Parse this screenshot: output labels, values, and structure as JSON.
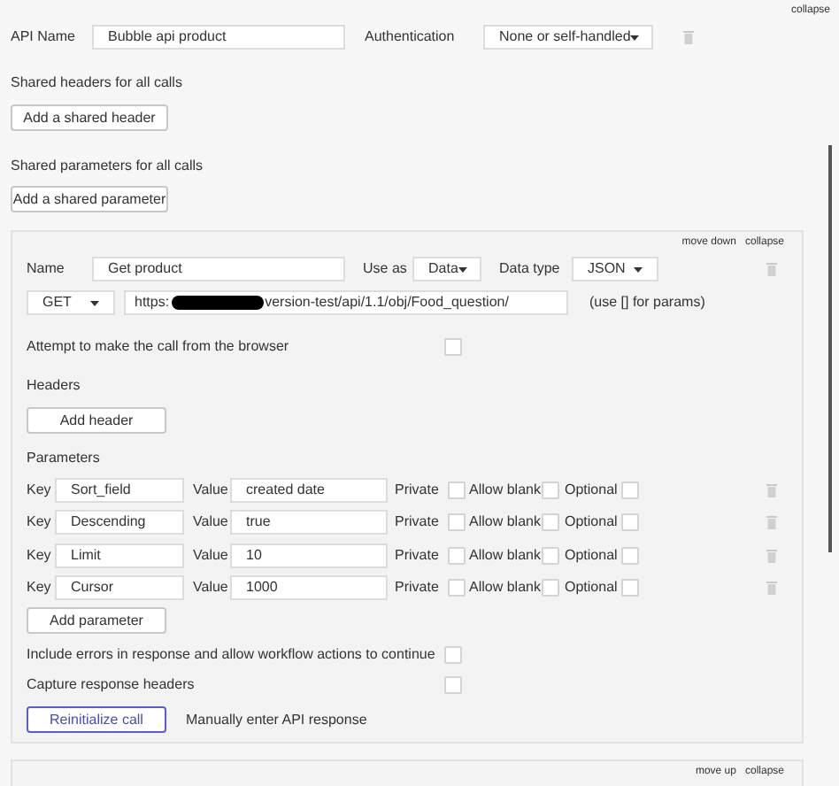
{
  "top_link": "collapse",
  "api": {
    "name_label": "API Name",
    "name_value": "Bubble api product",
    "auth_label": "Authentication",
    "auth_value": "None or self-handled"
  },
  "shared_headers": {
    "label": "Shared headers for all calls",
    "button": "Add a shared header"
  },
  "shared_params": {
    "label": "Shared parameters for all calls",
    "button": "Add a shared parameter"
  },
  "call": {
    "links": [
      "move down",
      "collapse"
    ],
    "name_label": "Name",
    "name_value": "Get product",
    "use_as_label": "Use as",
    "use_as_value": "Data",
    "data_type_label": "Data type",
    "data_type_value": "JSON",
    "method": "GET",
    "url_start": "https:",
    "url_end": "version-test/api/1.1/obj/Food_question/",
    "url_hint": "(use [] for params)",
    "browser_label": "Attempt to make the call from the browser",
    "browser_checked": false,
    "headers_label": "Headers",
    "add_header": "Add header",
    "parameters_label": "Parameters",
    "parameters": [
      {
        "key_label": "Key",
        "key": "Sort_field",
        "value_label": "Value",
        "value": "created date",
        "private_label": "Private",
        "private": false,
        "allow_blank_label": "Allow blank",
        "allow_blank": false,
        "optional_label": "Optional",
        "optional": false
      },
      {
        "key_label": "Key",
        "key": "Descending",
        "value_label": "Value",
        "value": "true",
        "private_label": "Private",
        "private": false,
        "allow_blank_label": "Allow blank",
        "allow_blank": false,
        "optional_label": "Optional",
        "optional": false
      },
      {
        "key_label": "Key",
        "key": "Limit",
        "value_label": "Value",
        "value": "10",
        "private_label": "Private",
        "private": false,
        "allow_blank_label": "Allow blank",
        "allow_blank": false,
        "optional_label": "Optional",
        "optional": false
      },
      {
        "key_label": "Key",
        "key": "Cursor",
        "value_label": "Value",
        "value": "1000",
        "private_label": "Private",
        "private": false,
        "allow_blank_label": "Allow blank",
        "allow_blank": false,
        "optional_label": "Optional",
        "optional": false
      }
    ],
    "add_parameter": "Add parameter",
    "options": [
      {
        "label": "Include errors in response and allow workflow actions to continue",
        "checked": false
      },
      {
        "label": "Capture response headers",
        "checked": false
      }
    ],
    "reinitialize": "Reinitialize call",
    "manual": "Manually enter API response"
  },
  "next_call": {
    "links": [
      "move up",
      "collapse"
    ]
  }
}
